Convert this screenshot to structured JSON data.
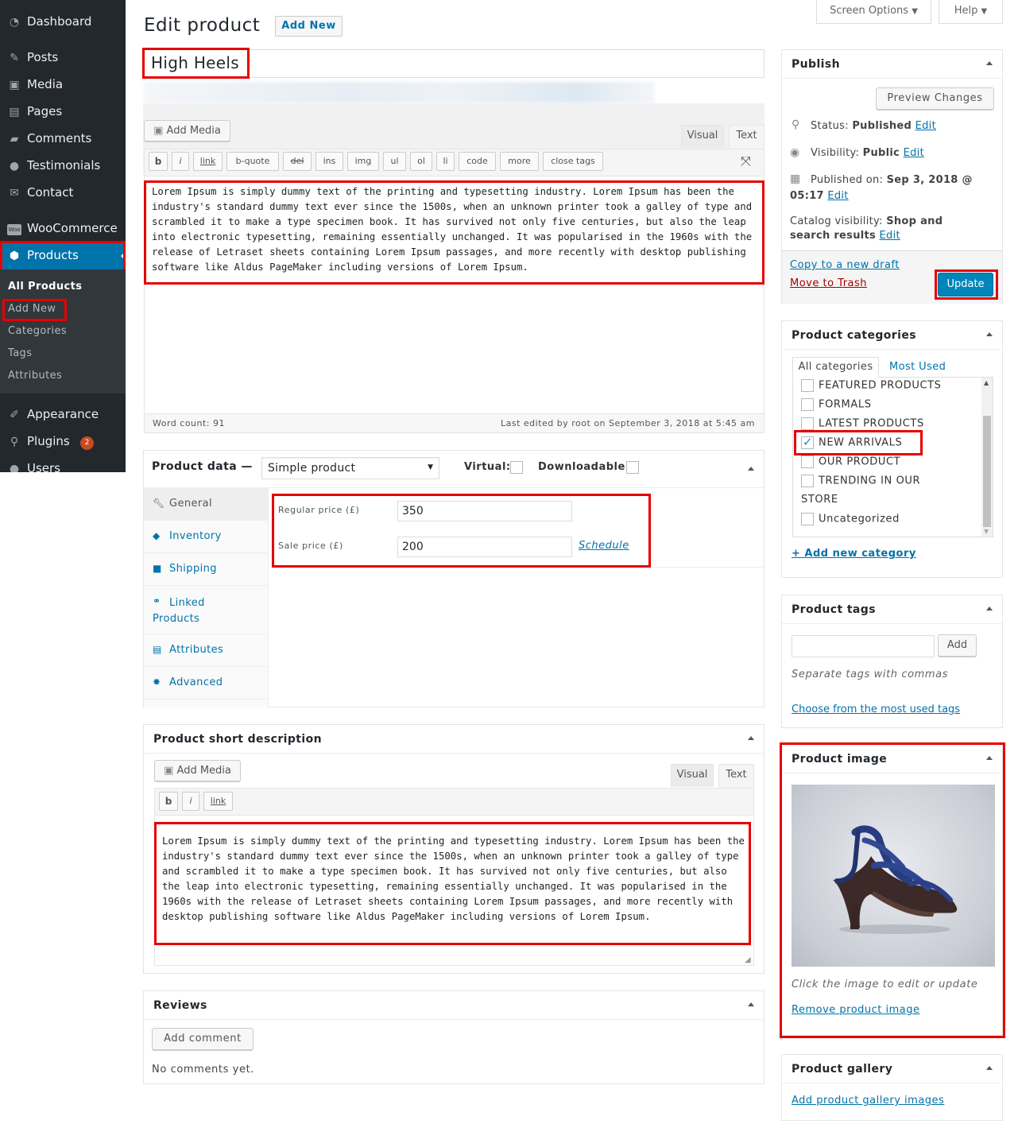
{
  "sidebar": {
    "menu": [
      {
        "id": "dashboard",
        "label": "Dashboard",
        "icon": "dashboard-icon"
      },
      {
        "id": "posts",
        "label": "Posts",
        "icon": "pin-icon"
      },
      {
        "id": "media",
        "label": "Media",
        "icon": "media-icon"
      },
      {
        "id": "pages",
        "label": "Pages",
        "icon": "pages-icon"
      },
      {
        "id": "comments",
        "label": "Comments",
        "icon": "comment-icon"
      },
      {
        "id": "testimonials",
        "label": "Testimonials",
        "icon": "user-icon"
      },
      {
        "id": "contact",
        "label": "Contact",
        "icon": "mail-icon"
      },
      {
        "id": "woocommerce",
        "label": "WooCommerce",
        "icon": "woo-icon",
        "icon_text": "Woo"
      },
      {
        "id": "products",
        "label": "Products",
        "icon": "box-icon"
      }
    ],
    "submenu": [
      "All Products",
      "Add New",
      "Categories",
      "Tags",
      "Attributes"
    ],
    "lower_menu": [
      {
        "id": "appearance",
        "label": "Appearance",
        "icon": "brush-icon"
      },
      {
        "id": "plugins",
        "label": "Plugins",
        "icon": "plugin-icon",
        "badge": "2"
      },
      {
        "id": "users",
        "label": "Users",
        "icon": "users-icon"
      }
    ]
  },
  "header": {
    "title": "Edit product",
    "add_new": "Add New",
    "screen_options": "Screen Options",
    "help": "Help"
  },
  "product": {
    "title": "High Heels"
  },
  "editor": {
    "add_media": "Add Media",
    "tab_visual": "Visual",
    "tab_text": "Text",
    "quicktags": [
      "b",
      "i",
      "link",
      "b-quote",
      "del",
      "ins",
      "img",
      "ul",
      "ol",
      "li",
      "code",
      "more",
      "close tags"
    ],
    "content": "Lorem Ipsum is simply dummy text of the printing and typesetting industry. Lorem Ipsum has been the industry's standard dummy text ever since the 1500s, when an unknown printer took a galley of type and scrambled it to make a type specimen book. It has survived not only five centuries, but also the leap into electronic typesetting, remaining essentially unchanged. It was popularised in the 1960s with the release of Letraset sheets containing Lorem Ipsum passages, and more recently with desktop publishing software like Aldus PageMaker including versions of Lorem Ipsum.",
    "word_count": "Word count: 91",
    "last_edited": "Last edited by root on September 3, 2018 at 5:45 am"
  },
  "product_data": {
    "title": "Product data —",
    "type": "Simple product",
    "virtual_label": "Virtual:",
    "downloadable_label": "Downloadable:",
    "tabs": [
      {
        "label": "General",
        "icon": "wrench-icon"
      },
      {
        "label": "Inventory",
        "icon": "tag-icon"
      },
      {
        "label": "Shipping",
        "icon": "truck-icon"
      },
      {
        "label": "Linked Products",
        "icon": "link-icon"
      },
      {
        "label": "Attributes",
        "icon": "list-icon"
      },
      {
        "label": "Advanced",
        "icon": "gear-icon"
      }
    ],
    "regular_price_label": "Regular price (£)",
    "regular_price": "350",
    "sale_price_label": "Sale price (£)",
    "sale_price": "200",
    "schedule": "Schedule"
  },
  "short_description": {
    "title": "Product short description",
    "add_media": "Add Media",
    "tab_visual": "Visual",
    "tab_text": "Text",
    "quicktags": [
      "b",
      "i",
      "link"
    ],
    "content": "Lorem Ipsum is simply dummy text of the printing and typesetting industry. Lorem Ipsum has been the industry's standard dummy text ever since the 1500s, when an unknown printer took a galley of type and scrambled it to make a type specimen book. It has survived not only five centuries, but also the leap into electronic typesetting, remaining essentially unchanged. It was popularised in the 1960s with the release of Letraset sheets containing Lorem Ipsum passages, and more recently with desktop publishing software like Aldus PageMaker including versions of Lorem Ipsum."
  },
  "reviews": {
    "title": "Reviews",
    "add_comment": "Add comment",
    "empty": "No comments yet."
  },
  "publish": {
    "title": "Publish",
    "preview": "Preview Changes",
    "status_label": "Status:",
    "status_value": "Published",
    "visibility_label": "Visibility:",
    "visibility_value": "Public",
    "published_label": "Published on:",
    "published_value_1": "Sep 3, 2018 @",
    "published_value_2": "05:17",
    "catalog_label": "Catalog visibility:",
    "catalog_value_1": "Shop and",
    "catalog_value_2": "search results",
    "edit": "Edit",
    "copy_draft": "Copy to a new draft",
    "trash": "Move to Trash",
    "update": "Update"
  },
  "categories": {
    "title": "Product categories",
    "tab_all": "All categories",
    "tab_most_used": "Most Used",
    "items": [
      {
        "label": "FEATURED PRODUCTS",
        "checked": false
      },
      {
        "label": "FORMALS",
        "checked": false
      },
      {
        "label": "LATEST PRODUCTS",
        "checked": false
      },
      {
        "label": "NEW ARRIVALS",
        "checked": true
      },
      {
        "label": "OUR PRODUCT",
        "checked": false
      },
      {
        "label": "TRENDING IN OUR",
        "checked": false
      },
      {
        "label": "STORE",
        "checked": false
      },
      {
        "label": "Uncategorized",
        "checked": false
      }
    ],
    "add_new": "+ Add new category"
  },
  "tags": {
    "title": "Product tags",
    "add": "Add",
    "hint": "Separate tags with commas",
    "choose": "Choose from the most used tags"
  },
  "product_image": {
    "title": "Product image",
    "hint": "Click the image to edit or update",
    "remove": "Remove product image"
  },
  "gallery": {
    "title": "Product gallery",
    "add": "Add product gallery images"
  },
  "colors": {
    "sidebar_bg": "#23282d",
    "sidebar_active": "#0073aa",
    "link": "#0073aa",
    "highlight": "#e60000",
    "badge": "#ca4a1f"
  }
}
